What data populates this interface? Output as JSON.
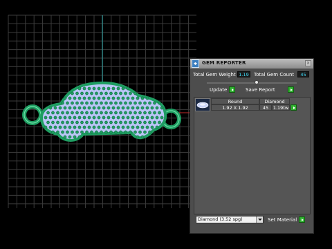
{
  "panel": {
    "title": "GEM REPORTER",
    "close_glyph": "x",
    "total_weight_label": "Total Gem Weight",
    "total_weight_value": "1.19",
    "total_count_label": "Total Gem Count",
    "total_count_value": "45",
    "update_label": "Update",
    "save_report_label": "Save Report",
    "table": {
      "shape_header": "Round",
      "material_header": "Diamond",
      "size": "1.92 X 1.92",
      "count": "45",
      "weight": "1.19tw"
    },
    "material_select_value": "Diamond   (3.52 spg)",
    "set_material_label": "Set Material"
  },
  "icons": {
    "app": "gem-reporter-app-icon",
    "go": "green-play-arrow-icon",
    "gem_thumb": "round-gem-icon",
    "dropdown": "chevron-down-icon"
  },
  "colors": {
    "viewport_bg": "#000000",
    "grid_line": "#3c3c3c",
    "axis_vertical": "#2aa6a6",
    "axis_horizontal": "#c22a2a",
    "metal": "#1f9e62",
    "gem": "#b9c6f5",
    "panel_bg": "#4d4d4d",
    "value_text": "#41e0ff",
    "go_button": "#2fb02f"
  }
}
